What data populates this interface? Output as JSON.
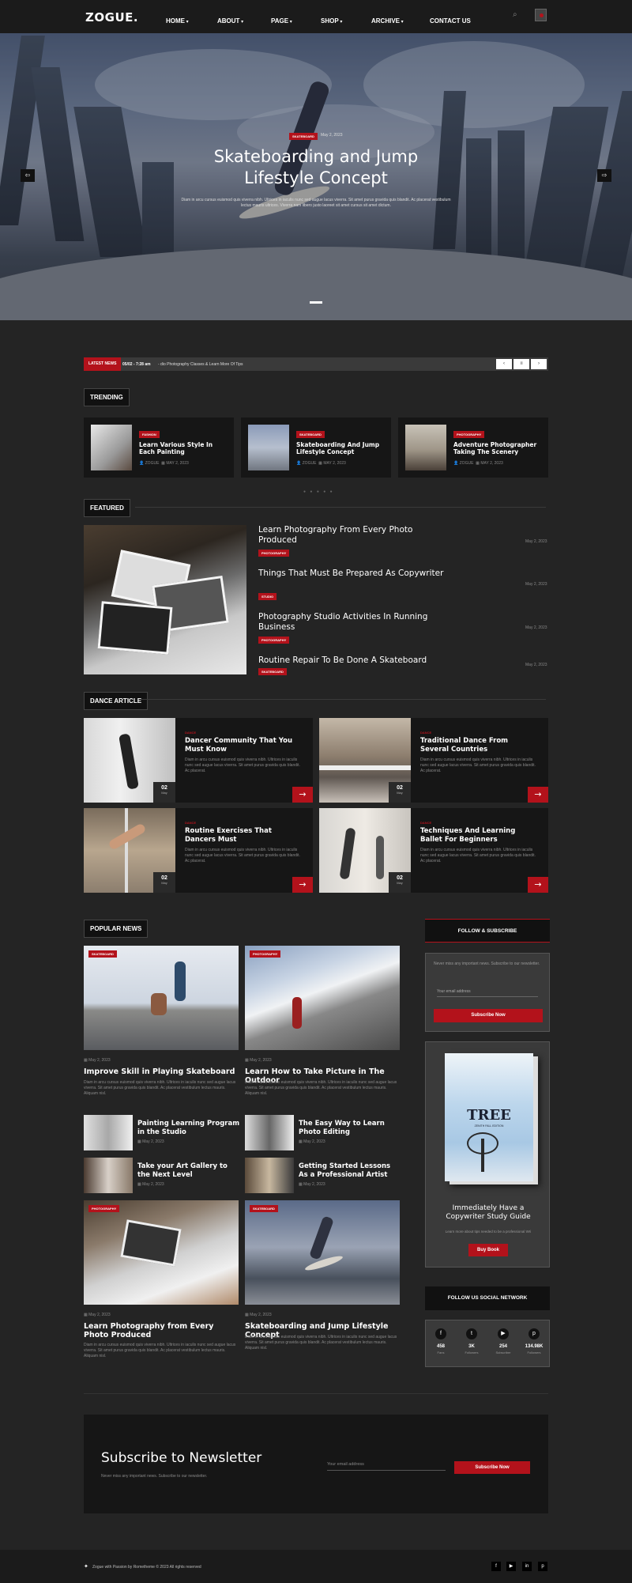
{
  "site": {
    "logo": "ZOGUE."
  },
  "nav": {
    "items": [
      "HOME",
      "ABOUT",
      "PAGE",
      "SHOP",
      "ARCHIVE",
      "CONTACT US"
    ]
  },
  "hero": {
    "tag": "SKATEBOARD",
    "date": "May 2, 2023",
    "title_line1": "Skateboarding and Jump",
    "title_line2": "Lifestyle Concept",
    "excerpt": "Diam in arcu cursus euismod quis viverra nibh. Ultrices in iaculis nunc sed augue lacus viverra. Sit amet purus gravida quis blandit. Ac placerat vestibulum lectus mauris ultrices. Viverra nam libero justo laoreet sit amet cursus sit amet dictum."
  },
  "ticker": {
    "label": "LATEST NEWS",
    "time": "05/02 - 7:28 am",
    "text": "- dio Photography Classes & Learn More Of Tips"
  },
  "trending": {
    "title": "TRENDING",
    "items": [
      {
        "tag": "FASHION",
        "title": "Learn Various Style In Each Painting",
        "author": "ZOGUE",
        "date": "MAY 2, 2023"
      },
      {
        "tag": "SKATEBOARD",
        "title": "Skateboarding And Jump Lifestyle Concept",
        "author": "ZOGUE",
        "date": "MAY 2, 2023"
      },
      {
        "tag": "PHOTOGRAPHY",
        "title": "Adventure Photographer Taking The Scenery",
        "author": "ZOGUE",
        "date": "MAY 2, 2023"
      }
    ]
  },
  "featured": {
    "title": "FEATURED",
    "items": [
      {
        "title": "Learn Photography From Every Photo Produced",
        "tag": "PHOTOGRAPHY",
        "date": "May 2, 2023"
      },
      {
        "title": "Things That Must Be Prepared As Copywriter",
        "tag": "STUDIO",
        "date": "May 2, 2023"
      },
      {
        "title": "Photography Studio Activities In Running Business",
        "tag": "PHOTOGRAPHY",
        "date": "May 2, 2023"
      },
      {
        "title": "Routine Repair To Be Done A Skateboard",
        "tag": "SKATEBOARD",
        "date": "May 2, 2023"
      }
    ]
  },
  "dance": {
    "title": "DANCE ARTICLE",
    "excerpt": "Diam in arcu cursus euismod quis viverra nibh. Ultrices in iaculis nunc sed augue lacus viverra. Sit amet purus gravida quis blandit. Ac placerat.",
    "tag": "DANCE",
    "day": "02",
    "month": "May",
    "items": [
      {
        "title": "Dancer Community That You Must Know"
      },
      {
        "title": "Traditional Dance From Several Countries"
      },
      {
        "title": "Routine Exercises That Dancers Must"
      },
      {
        "title": "Techniques And Learning Ballet For Beginners"
      }
    ]
  },
  "popular": {
    "title": "POPULAR NEWS",
    "excerpt": "Diam in arcu cursus euismod quis viverra nibh. Ultrices in iaculis nunc sed augue lacus viverra. Sit amet purus gravida quis blandit. Ac placerat vestibulum lectus mauris. Aliquam nisl.",
    "big": [
      {
        "tag": "SKATEBOARD",
        "date": "May 2, 2023",
        "title": "Improve Skill in Playing Skateboard"
      },
      {
        "tag": "PHOTOGRAPHY",
        "date": "May 2, 2023",
        "title": "Learn How to Take Picture in The Outdoor"
      },
      {
        "tag": "PHOTOGRAPHY",
        "date": "May 2, 2023",
        "title": "Learn Photography from Every Photo Produced"
      },
      {
        "tag": "SKATEBOARD",
        "date": "May 2, 2023",
        "title": "Skateboarding and Jump Lifestyle Concept"
      }
    ],
    "small": [
      {
        "title": "Painting Learning Program in the Studio",
        "date": "May 2, 2023"
      },
      {
        "title": "The Easy Way to Learn Photo Editing",
        "date": "May 2, 2023"
      },
      {
        "title": "Take your Art Gallery to the Next Level",
        "date": "May 2, 2023"
      },
      {
        "title": "Getting Started Lessons As a Professional Artist",
        "date": "May 2, 2023"
      }
    ]
  },
  "sidebar": {
    "follow_title": "FOLLOW & SUBSCRIBE",
    "follow_text": "Never miss any important news. Subscribe to our newsletter.",
    "email_placeholder": "Your email address",
    "subscribe_btn": "Subscribe Now",
    "book_title": "TREE",
    "book_subtitle": "ZENITH FALL EDITION",
    "book_heading": "Immediately Have a Copywriter Study Guide",
    "book_text": "Learn more about tips needed to be a professional Wri",
    "book_btn": "Buy Book",
    "social_title": "FOLLOW US SOCIAL NETWORK",
    "social": [
      {
        "icon": "facebook-icon",
        "glyph": "f",
        "count": "458",
        "label": "Fans"
      },
      {
        "icon": "twitter-icon",
        "glyph": "t",
        "count": "3K",
        "label": "Followers"
      },
      {
        "icon": "youtube-icon",
        "glyph": "▶",
        "count": "254",
        "label": "Subscriber"
      },
      {
        "icon": "pinterest-icon",
        "glyph": "p",
        "count": "134.98K",
        "label": "Followers"
      }
    ]
  },
  "newsletter": {
    "title": "Subscribe to Newsletter",
    "text": "Never miss any important news. Subscribe to our newsletter.",
    "placeholder": "Your email address",
    "button": "Subscribe Now"
  },
  "footer": {
    "text": "Zogue with Passion by Rometheme © 2023 All rights reserved"
  },
  "colors": {
    "accent": "#b3121b",
    "bg": "#242424",
    "card": "#161616"
  }
}
